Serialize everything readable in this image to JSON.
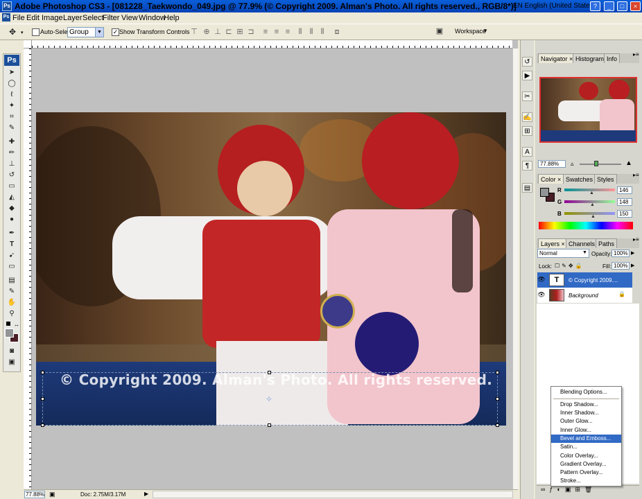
{
  "window": {
    "title": "Adobe Photoshop CS3 - [081228_Taekwondo_049.jpg @ 77.9% (© Copyright 2009. Alman's Photo. All rights reserved., RGB/8*)]",
    "language": "EN English (United States)"
  },
  "menus": [
    "File",
    "Edit",
    "Image",
    "Layer",
    "Select",
    "Filter",
    "View",
    "Window",
    "Help"
  ],
  "options_bar": {
    "auto_select_label": "Auto-Select:",
    "auto_select_value": "Group",
    "show_transform_label": "Show Transform Controls",
    "show_transform_checked": true,
    "workspace_label": "Workspace"
  },
  "toolbox": {
    "logo": "Ps"
  },
  "canvas": {
    "copyright_text": "© Copyright 2009. Alman's Photo. All rights reserved."
  },
  "status_bar": {
    "zoom": "77.88%",
    "doc_info": "Doc: 2.75M/3.17M"
  },
  "navigator": {
    "tabs": [
      "Navigator",
      "Histogram",
      "Info"
    ],
    "zoom": "77.88%"
  },
  "color_panel": {
    "tabs": [
      "Color",
      "Swatches",
      "Styles"
    ],
    "r_label": "R",
    "g_label": "G",
    "b_label": "B",
    "r": "146",
    "g": "148",
    "b": "150"
  },
  "layers_panel": {
    "tabs": [
      "Layers",
      "Channels",
      "Paths"
    ],
    "blend_mode": "Normal",
    "opacity_label": "Opacity:",
    "opacity": "100%",
    "lock_label": "Lock:",
    "fill_label": "Fill:",
    "fill": "100%",
    "layers": [
      {
        "name": "© Copyright 2009....",
        "type": "text",
        "thumb": "T"
      },
      {
        "name": "Background",
        "type": "image"
      }
    ]
  },
  "context_menu": {
    "items": [
      "Blending Options...",
      "Drop Shadow...",
      "Inner Shadow...",
      "Outer Glow...",
      "Inner Glow...",
      "Bevel and Emboss...",
      "Satin...",
      "Color Overlay...",
      "Gradient Overlay...",
      "Pattern Overlay...",
      "Stroke..."
    ],
    "highlighted_index": 5
  },
  "colors": {
    "titlebar": "#0a5fd8",
    "highlight": "#316ac5",
    "nav_frame": "#e03030"
  }
}
